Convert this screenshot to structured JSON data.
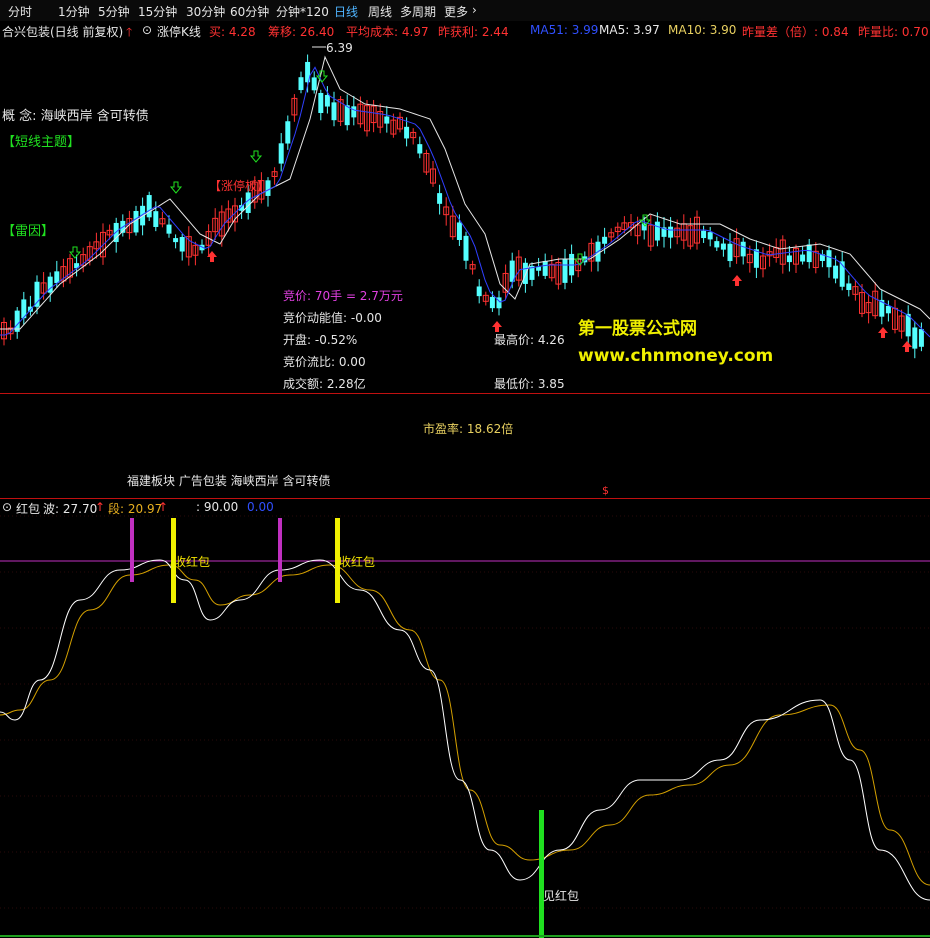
{
  "toolbar": {
    "items": [
      "分时",
      "1分钟",
      "5分钟",
      "15分钟",
      "30分钟",
      "60分钟",
      "分钟*120",
      "日线",
      "周线",
      "多周期",
      "更多"
    ],
    "active": "日线"
  },
  "stock_info": {
    "name": "合兴包装(日线 前复权)",
    "kline_type": "涨停K线",
    "buy": "买: 4.28",
    "chip_shift": "筹移: 26.40",
    "avg_cost": "平均成本: 4.97",
    "yesterday_profit": "昨获利: 2.44",
    "ma51": "MA51: 3.99",
    "ma5": "MA5: 3.97",
    "ma10": "MA10: 3.90",
    "yesterday_diff": "昨量差（倍）: 0.84",
    "yesterday_ratio": "昨量比: 0.70"
  },
  "chart_labels": {
    "peak_price": "6.39",
    "concept": "概 念: 海峡西岸 含可转债",
    "short_theme": "【短线主题】",
    "thunder": "【雷因】",
    "limit_up_tag": "【涨停板】"
  },
  "auction": {
    "price": "竞价: 70手 = 2.7万元",
    "momentum": "竞价动能值: -0.00",
    "open": "开盘: -0.52%",
    "flow_ratio": "竞价流比: 0.00",
    "turnover": "成交额: 2.28亿",
    "high": "最高价: 4.26",
    "low": "最低价: 3.85"
  },
  "watermark": {
    "site_name": "第一股票公式网",
    "url": "www.chnmoney.com"
  },
  "mid_panel": {
    "pe": "市盈率: 18.62倍",
    "sectors": "福建板块 广告包装 海峡西岸 含可转债",
    "dollar": "$"
  },
  "indicator": {
    "name": "红包",
    "wave": "波: 27.70",
    "segment": "段: 20.97",
    "level": ": 90.00",
    "blue_val": "0.00",
    "label_receive1": "收红包",
    "label_receive2": "收红包",
    "label_see": "见红包"
  },
  "colors": {
    "up": "#ff3232",
    "down": "#54ffff",
    "ma_white": "#e6e6e6",
    "ma_blue": "#3040ff",
    "magenta": "#c030c0",
    "yellow": "#f0f000",
    "green": "#20e020",
    "gold": "#d4a000"
  }
}
